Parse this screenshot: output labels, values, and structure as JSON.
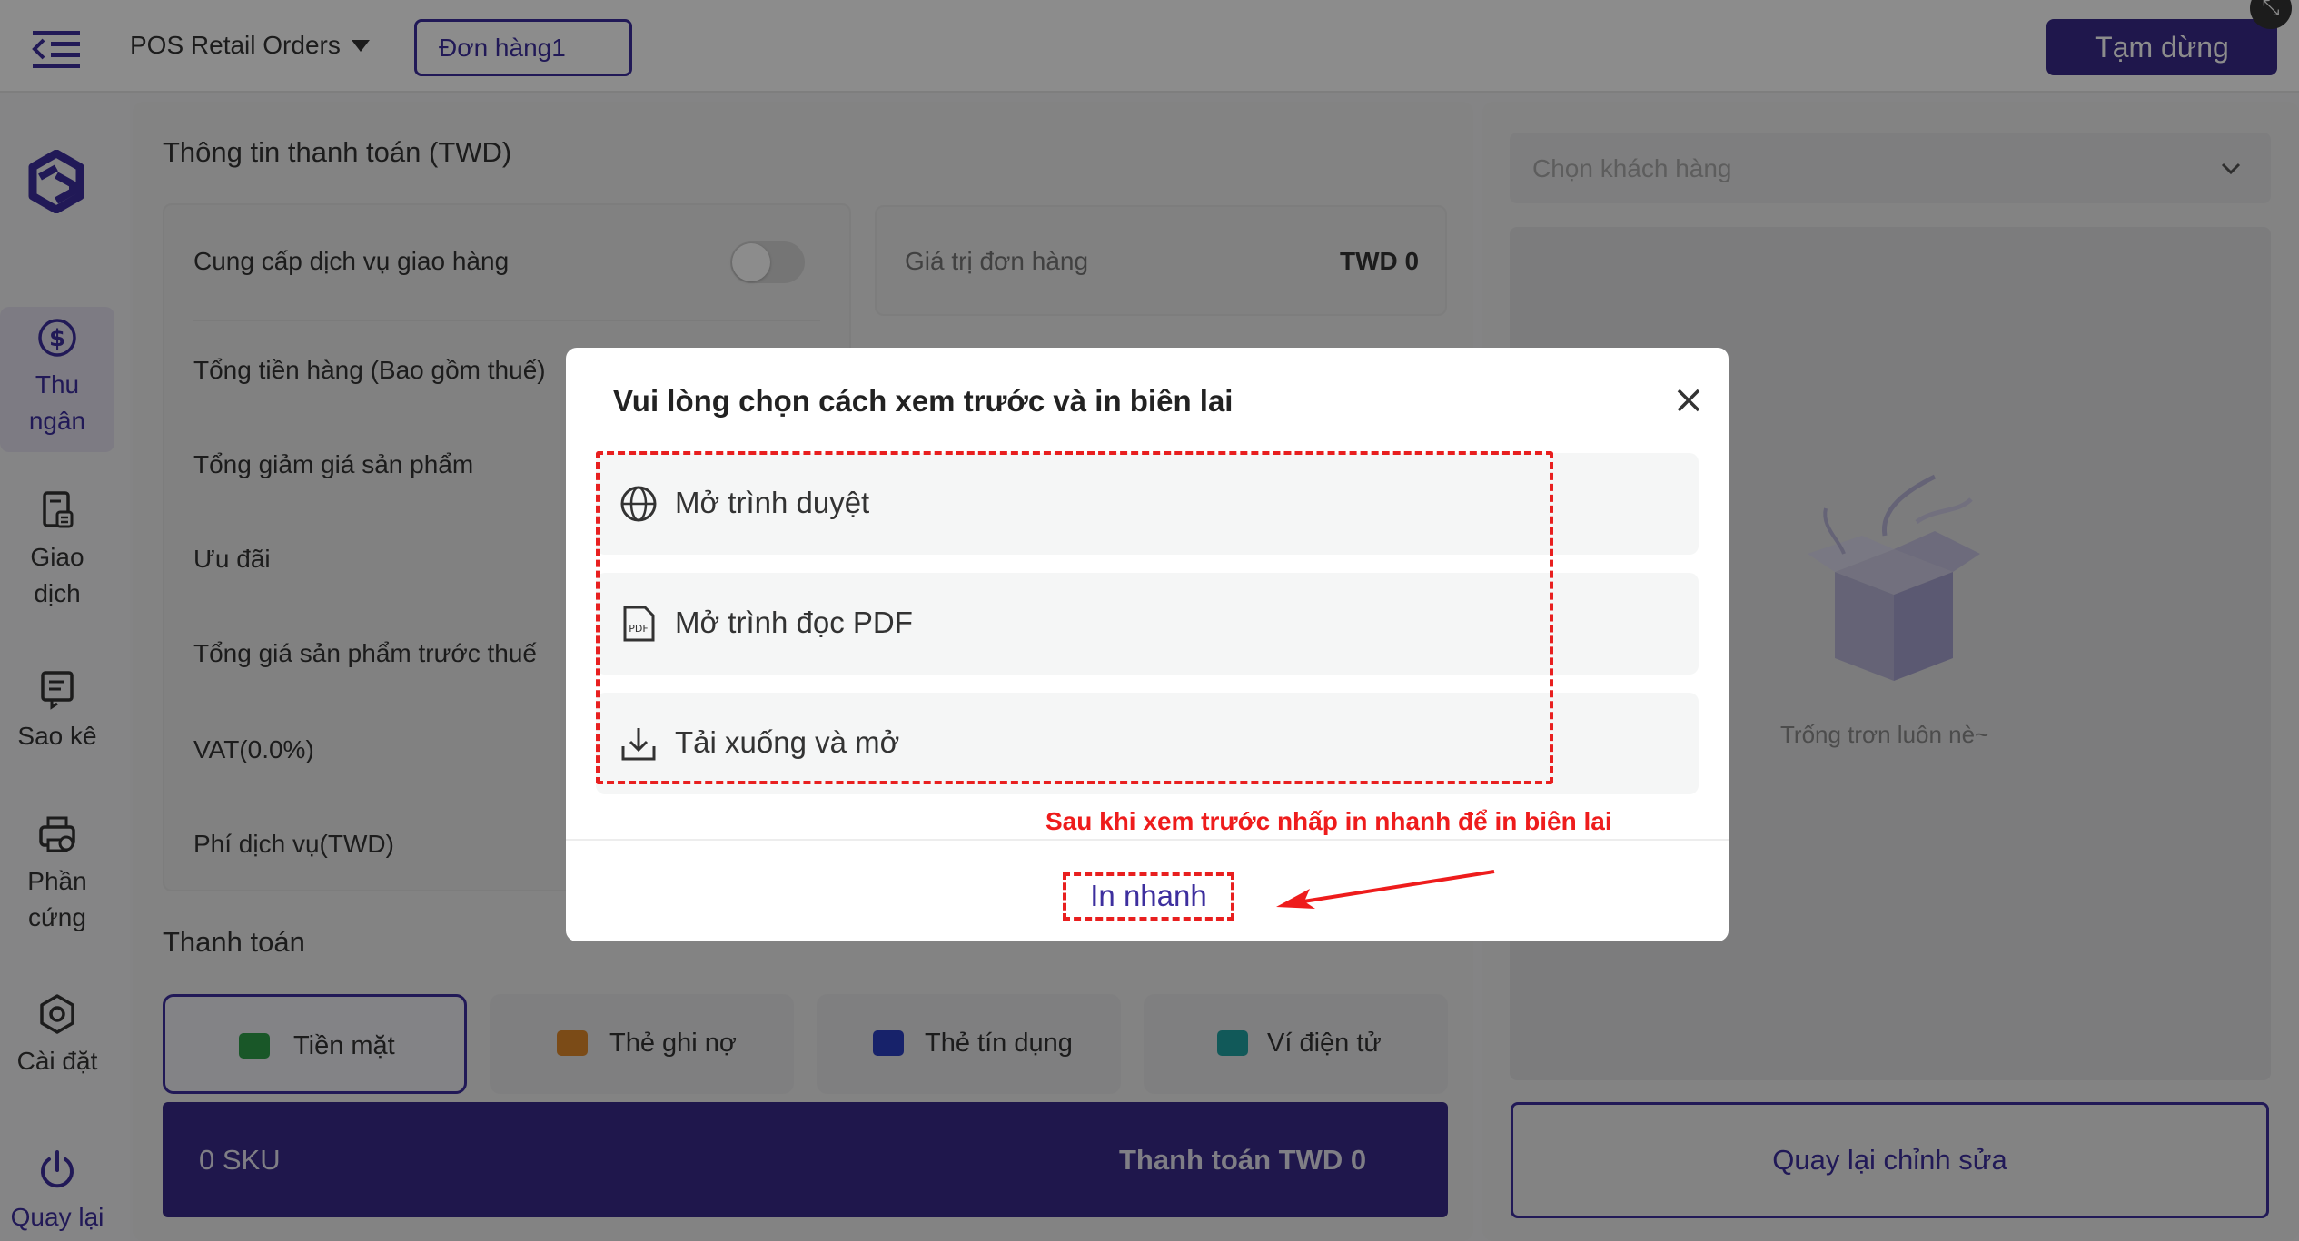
{
  "header": {
    "app_name": "POS Retail Orders",
    "order_tab": "Đơn hàng1",
    "pause_button": "Tạm dừng"
  },
  "sidebar": {
    "items": [
      {
        "label": "Thu\nngân",
        "line1": "Thu",
        "line2": "ngân",
        "icon": "dollar-circle-icon",
        "active": true
      },
      {
        "label": "Giao dịch",
        "line1": "Giao",
        "line2": "dịch",
        "icon": "receipt-icon",
        "active": false
      },
      {
        "label": "Sao kê",
        "line1": "Sao kê",
        "line2": "",
        "icon": "statement-icon",
        "active": false
      },
      {
        "label": "Phần cứng",
        "line1": "Phần",
        "line2": "cứng",
        "icon": "printer-icon",
        "active": false
      },
      {
        "label": "Cài đặt",
        "line1": "Cài đặt",
        "line2": "",
        "icon": "gear-icon",
        "active": false
      },
      {
        "label": "Quay lại",
        "line1": "Quay lại",
        "line2": "",
        "icon": "power-icon",
        "active": false
      }
    ]
  },
  "payment_info": {
    "title": "Thông tin thanh toán  (TWD)",
    "delivery_label": "Cung cấp dịch vụ giao hàng",
    "rows": [
      "Tổng tiền hàng (Bao gồm thuế)",
      "Tổng giảm giá sản phẩm",
      "Ưu đãi",
      "Tổng giá sản phẩm trước thuế",
      "VAT(0.0%)",
      "Phí dịch vụ(TWD)"
    ],
    "order_value_label": "Giá trị đơn hàng",
    "order_value": "TWD 0"
  },
  "payment": {
    "title": "Thanh toán",
    "methods": [
      {
        "label": "Tiền mặt",
        "icon": "cash-icon",
        "color": "#2e9e4a",
        "active": true
      },
      {
        "label": "Thẻ ghi nợ",
        "icon": "debit-card-icon",
        "color": "#e0892a",
        "active": false
      },
      {
        "label": "Thẻ tín dụng",
        "icon": "credit-card-icon",
        "color": "#2b3ec2",
        "active": false
      },
      {
        "label": "Ví điện tử",
        "icon": "wallet-icon",
        "color": "#1fa3a3",
        "active": false
      }
    ],
    "sku_count": "0 SKU",
    "checkout": "Thanh toán TWD 0"
  },
  "right_panel": {
    "customer_placeholder": "Chọn khách hàng",
    "empty_text": "Trống trơn luôn nè~",
    "back_button": "Quay lại chỉnh sửa"
  },
  "modal": {
    "title": "Vui lòng chọn cách xem trước và in biên lai",
    "options": [
      {
        "label": "Mở trình duyệt",
        "icon": "globe-icon"
      },
      {
        "label": "Mở trình đọc PDF",
        "icon": "pdf-icon"
      },
      {
        "label": "Tải xuống và mở",
        "icon": "download-icon"
      }
    ],
    "annotation": "Sau khi xem trước nhấp in nhanh để in biên lai",
    "quick_print": "In nhanh"
  },
  "colors": {
    "brand": "#3a2a8a",
    "accent": "#3d2f9e",
    "annotation": "#e81f1f"
  }
}
